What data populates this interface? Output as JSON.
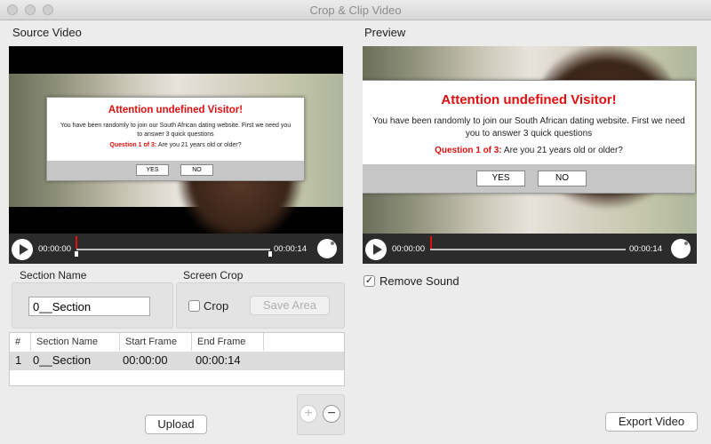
{
  "window": {
    "title": "Crop & Clip Video"
  },
  "source": {
    "label": "Source Video",
    "dialog": {
      "title": "Attention undefined Visitor!",
      "body": "You have been randomly to join our South African dating website. First we need you to answer 3 quick questions",
      "question_prefix": "Question 1 of 3:",
      "question": " Are you 21 years old or older?",
      "yes": "YES",
      "no": "NO"
    },
    "time_start": "00:00:00",
    "time_end": "00:00:14"
  },
  "preview": {
    "label": "Preview",
    "dialog": {
      "title": "Attention undefined Visitor!",
      "body": "You have been randomly to join our South African dating website. First we need you to answer 3 quick questions",
      "question_prefix": "Question 1 of 3:",
      "question": " Are you 21 years old or older?",
      "yes": "YES",
      "no": "NO"
    },
    "time_start": "00:00:00",
    "time_end": "00:00:14"
  },
  "section_name": {
    "label": "Section Name",
    "value": "0__Section"
  },
  "screen_crop": {
    "label": "Screen Crop",
    "crop_label": "Crop",
    "crop_checked": false,
    "save_area": "Save Area"
  },
  "table": {
    "headers": [
      "#",
      "Section Name",
      "Start Frame",
      "End Frame"
    ],
    "rows": [
      {
        "num": "1",
        "name": "0__Section",
        "start": "00:00:00",
        "end": "00:00:14"
      }
    ]
  },
  "buttons": {
    "upload": "Upload",
    "export": "Export Video",
    "add": "+",
    "remove": "−"
  },
  "remove_sound": {
    "label": "Remove Sound",
    "checked": true,
    "check_glyph": "✓"
  },
  "colors": {
    "accent_red": "#e01010",
    "player_bg": "#2b2b2b",
    "window_bg": "#ececec"
  }
}
